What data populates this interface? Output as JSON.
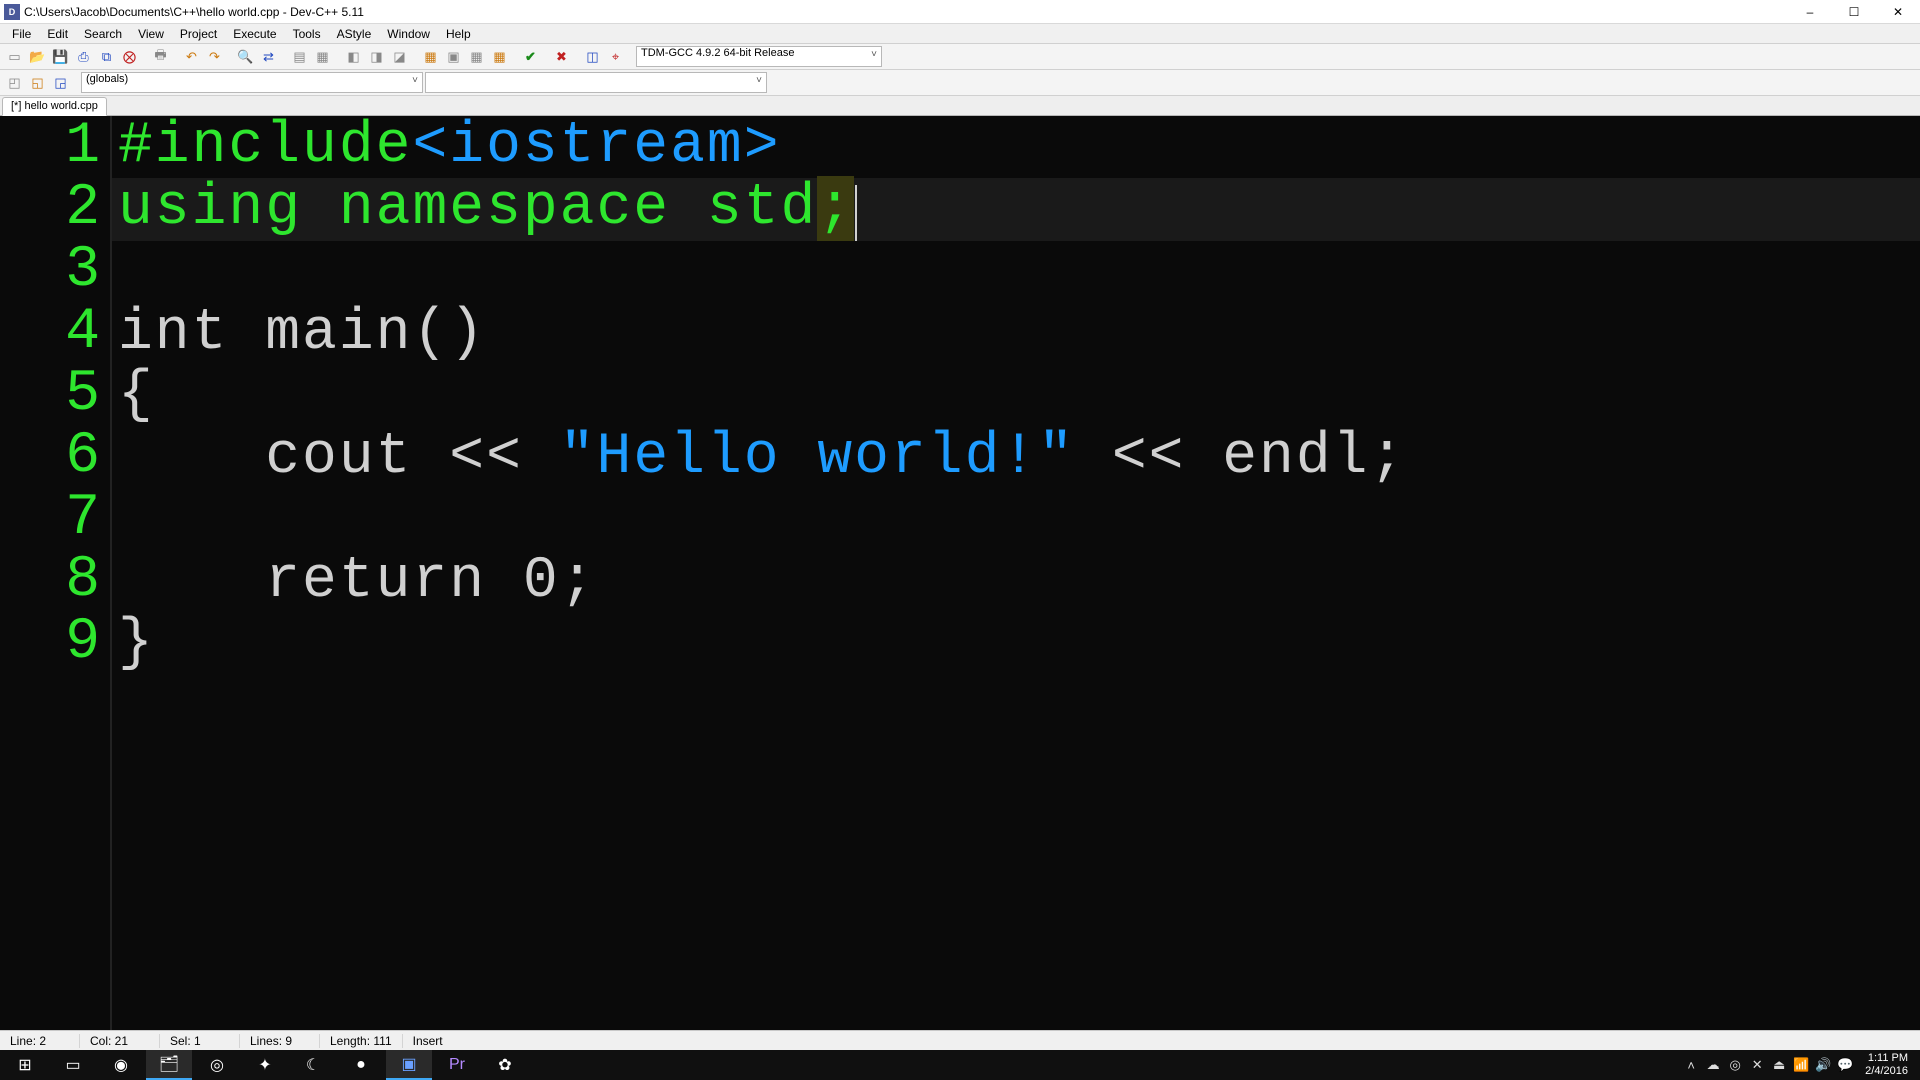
{
  "window": {
    "title": "C:\\Users\\Jacob\\Documents\\C++\\hello world.cpp - Dev-C++ 5.11",
    "minimize": "–",
    "maximize": "☐",
    "close": "✕"
  },
  "menu": [
    "File",
    "Edit",
    "Search",
    "View",
    "Project",
    "Execute",
    "Tools",
    "AStyle",
    "Window",
    "Help"
  ],
  "toolbar1": {
    "compiler_select": "TDM-GCC 4.9.2 64-bit Release"
  },
  "toolbar2": {
    "class_select": "(globals)",
    "func_select": ""
  },
  "tab": {
    "label": "[*] hello world.cpp"
  },
  "code": {
    "linenums": [
      "1",
      "2",
      "3",
      "4",
      "5",
      "6",
      "7",
      "8",
      "9"
    ],
    "l1_pp": "#include",
    "l1_angle": "<iostream>",
    "l2_kw1": "using",
    "l2_kw2": "namespace",
    "l2_name": "std",
    "l2_semi": ";",
    "l4_kw": "int",
    "l4_name": "main()",
    "l5_brace": "{",
    "l6_ident": "cout",
    "l6_op1": "<<",
    "l6_str": "\"Hello world!\"",
    "l6_op2": "<<",
    "l6_endl": "endl",
    "l6_semi": ";",
    "l8_indent": "    ",
    "l8_kw": "return",
    "l8_num": "0",
    "l8_semi": ";",
    "l9_brace": "}"
  },
  "status": {
    "line": "Line:   2",
    "col": "Col:   21",
    "sel": "Sel:   1",
    "lines": "Lines:   9",
    "length": "Length:   111",
    "mode": "Insert"
  },
  "taskbar": {
    "time": "1:11 PM",
    "date": "2/4/2016"
  }
}
